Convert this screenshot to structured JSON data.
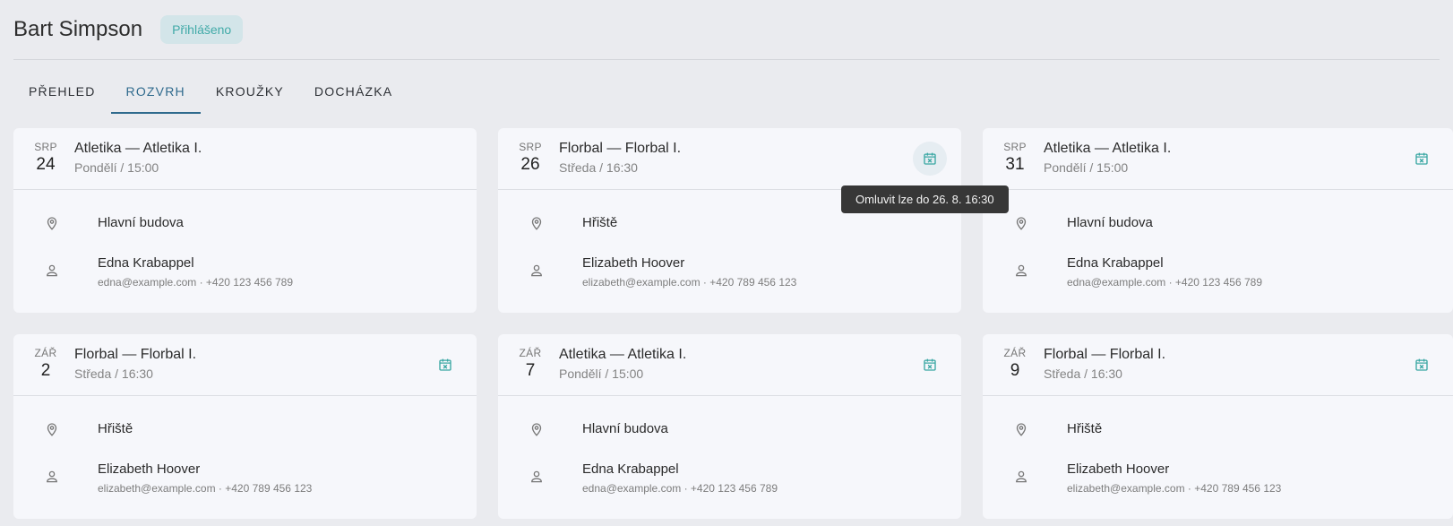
{
  "header": {
    "title": "Bart Simpson",
    "badge": "Přihlášeno"
  },
  "tabs": [
    {
      "label": "PŘEHLED",
      "active": false
    },
    {
      "label": "ROZVRH",
      "active": true
    },
    {
      "label": "KROUŽKY",
      "active": false
    },
    {
      "label": "DOCHÁZKA",
      "active": false
    }
  ],
  "tooltip": "Omluvit lze do 26. 8. 16:30",
  "colors": {
    "accent": "#2f6a8d",
    "badge_bg": "#d3e5e9",
    "badge_text": "#41aaa8",
    "excuse_icon": "#3aa7a3"
  },
  "cards": [
    {
      "month": "SRP",
      "day": "24",
      "course": "Atletika — Atletika I.",
      "time": "Pondělí / 15:00",
      "place": "Hlavní budova",
      "teacher": "Edna Krabappel",
      "contact": "edna@example.com · +420 123 456 789",
      "excuse": false
    },
    {
      "month": "SRP",
      "day": "26",
      "course": "Florbal — Florbal I.",
      "time": "Středa / 16:30",
      "place": "Hřiště",
      "teacher": "Elizabeth Hoover",
      "contact": "elizabeth@example.com · +420 789 456 123",
      "excuse": true
    },
    {
      "month": "SRP",
      "day": "31",
      "course": "Atletika — Atletika I.",
      "time": "Pondělí / 15:00",
      "place": "Hlavní budova",
      "teacher": "Edna Krabappel",
      "contact": "edna@example.com · +420 123 456 789",
      "excuse": true
    },
    {
      "month": "ZÁŘ",
      "day": "2",
      "course": "Florbal — Florbal I.",
      "time": "Středa / 16:30",
      "place": "Hřiště",
      "teacher": "Elizabeth Hoover",
      "contact": "elizabeth@example.com · +420 789 456 123",
      "excuse": true
    },
    {
      "month": "ZÁŘ",
      "day": "7",
      "course": "Atletika — Atletika I.",
      "time": "Pondělí / 15:00",
      "place": "Hlavní budova",
      "teacher": "Edna Krabappel",
      "contact": "edna@example.com · +420 123 456 789",
      "excuse": true
    },
    {
      "month": "ZÁŘ",
      "day": "9",
      "course": "Florbal — Florbal I.",
      "time": "Středa / 16:30",
      "place": "Hřiště",
      "teacher": "Elizabeth Hoover",
      "contact": "elizabeth@example.com · +420 789 456 123",
      "excuse": true
    }
  ]
}
